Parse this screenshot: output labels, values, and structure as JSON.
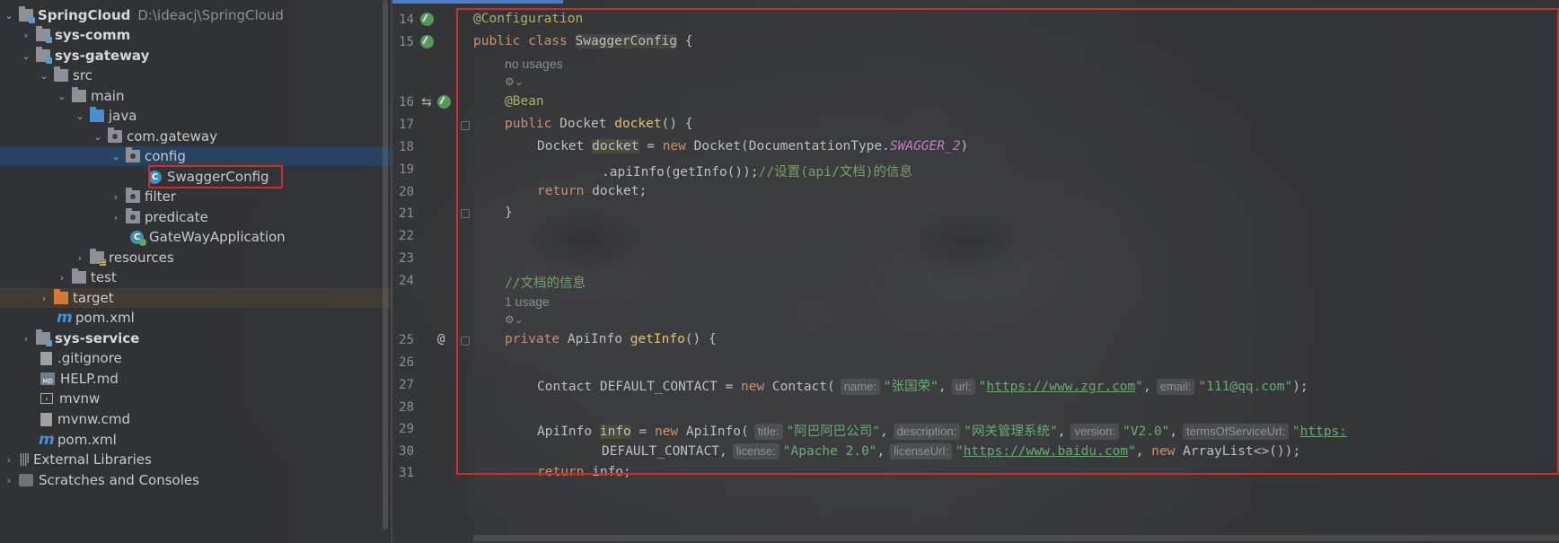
{
  "project_tree": {
    "root": {
      "label": "SpringCloud",
      "path": "D:\\ideacj\\SpringCloud"
    },
    "items": [
      {
        "label": "sys-comm"
      },
      {
        "label": "sys-gateway"
      },
      {
        "label": "src"
      },
      {
        "label": "main"
      },
      {
        "label": "java"
      },
      {
        "label": "com.gateway"
      },
      {
        "label": "config"
      },
      {
        "label": "SwaggerConfig"
      },
      {
        "label": "filter"
      },
      {
        "label": "predicate"
      },
      {
        "label": "GateWayApplication"
      },
      {
        "label": "resources"
      },
      {
        "label": "test"
      },
      {
        "label": "target"
      },
      {
        "label": "pom.xml"
      },
      {
        "label": "sys-service"
      },
      {
        "label": ".gitignore"
      },
      {
        "label": "HELP.md"
      },
      {
        "label": "mvnw"
      },
      {
        "label": "mvnw.cmd"
      },
      {
        "label": "pom.xml"
      },
      {
        "label": "External Libraries"
      },
      {
        "label": "Scratches and Consoles"
      }
    ]
  },
  "editor": {
    "line_numbers": [
      "14",
      "15",
      "16",
      "17",
      "18",
      "19",
      "20",
      "21",
      "22",
      "23",
      "24",
      "25",
      "26",
      "27",
      "28",
      "29",
      "30",
      "31"
    ],
    "usages": {
      "no_usages": "no usages",
      "one_usage": "1 usage"
    },
    "code": {
      "l14_ann": "@Configuration",
      "l15_kw": "public class ",
      "l15_cls": "SwaggerConfig",
      "l15_rest": " {",
      "l16_ann": "@Bean",
      "l17_kw": "public ",
      "l17_type": "Docket ",
      "l17_fn": "docket",
      "l17_rest": "() {",
      "l18_type": "Docket ",
      "l18_var": "docket",
      "l18_eq": " = ",
      "l18_new": "new ",
      "l18_call": "Docket(DocumentationType.",
      "l18_const": "SWAGGER_2",
      "l18_end": ")",
      "l19_call": ".apiInfo(getInfo());",
      "l19_cmt": "//设置(api/文档)的信息",
      "l20_kw": "return ",
      "l20_rest": "docket;",
      "l21": "}",
      "l24_cmt": "//文档的信息",
      "l25_kw": "private ",
      "l25_type": "ApiInfo ",
      "l25_fn": "getInfo",
      "l25_rest": "() {",
      "l27_a": "Contact DEFAULT_CONTACT = ",
      "l27_new": "new ",
      "l27_b": "Contact(",
      "l27_hint1": "name:",
      "l27_s1": "\"张国荣\"",
      "l27_c1": ",",
      "l27_hint2": "url:",
      "l27_s2q1": "\"",
      "l27_s2": "https://www.zgr.com",
      "l27_s2q2": "\"",
      "l27_c2": ",",
      "l27_hint3": "email:",
      "l27_s3": "\"111@qq.com\"",
      "l27_end": ");",
      "l29_a": "ApiInfo ",
      "l29_var": "info",
      "l29_eq": " = ",
      "l29_new": "new ",
      "l29_b": "ApiInfo(",
      "l29_hint1": "title:",
      "l29_s1": "\"阿巴阿巴公司\"",
      "l29_c1": ",",
      "l29_hint2": "description:",
      "l29_s2": "\"网关管理系统\"",
      "l29_c2": ",",
      "l29_hint3": "version:",
      "l29_s3": "\"V2.0\"",
      "l29_c3": ",",
      "l29_hint4": "termsOfServiceUrl:",
      "l29_s4q": "\"",
      "l29_s4": "https:",
      "l30_a": "DEFAULT_CONTACT,",
      "l30_hint1": "license:",
      "l30_s1": "\"Apache 2.0\"",
      "l30_c1": ",",
      "l30_hint2": "licenseUrl:",
      "l30_s2q1": "\"",
      "l30_s2": "https://www.baidu.com",
      "l30_s2q2": "\"",
      "l30_c2": ", ",
      "l30_new": "new ",
      "l30_end": "ArrayList<>());",
      "l31_kw": "return ",
      "l31_rest": "info;"
    }
  },
  "colors": {
    "selection": "#264669",
    "highlight_border": "#c9302c",
    "keyword": "#cf8e6d",
    "annotation": "#b3ae60",
    "string": "#6aab73",
    "comment": "#7a9f6b",
    "constant": "#c77dbb"
  }
}
